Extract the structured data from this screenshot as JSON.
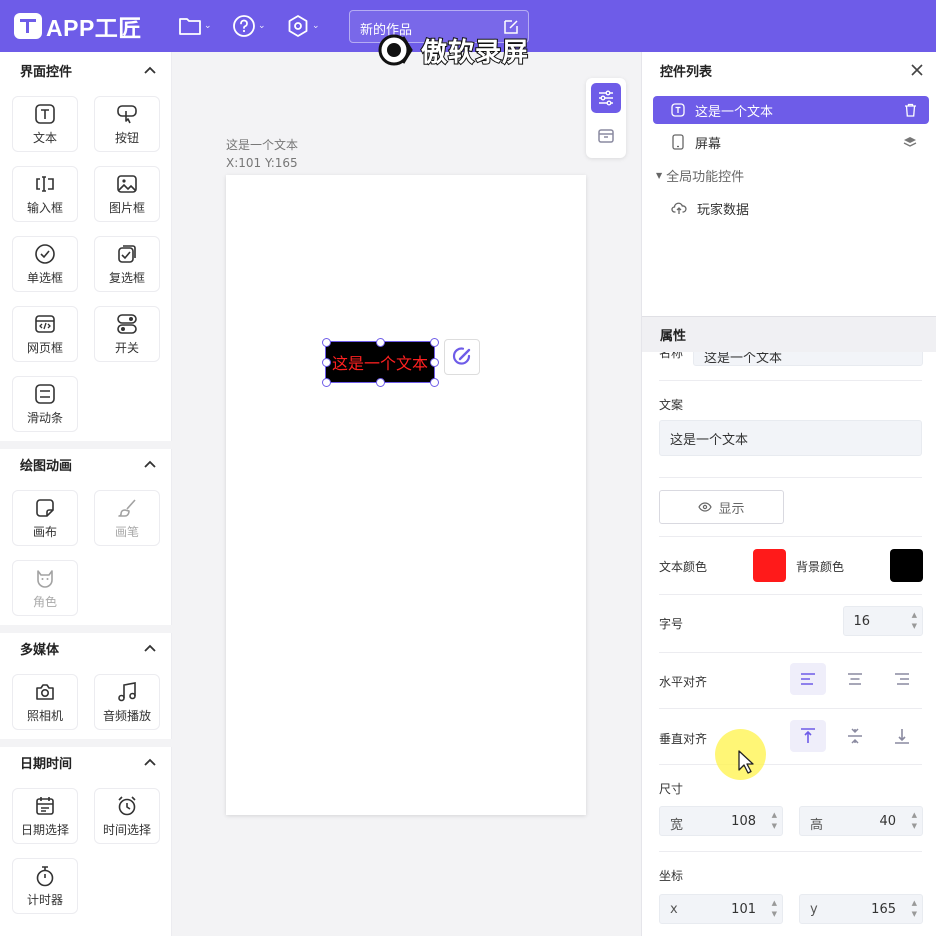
{
  "app": {
    "name": "APP工匠",
    "project_title": "新的作品",
    "watermark_text": "傲软录屏"
  },
  "toolbar_icons": [
    "folder-icon",
    "help-icon",
    "settings-icon",
    "edit-icon"
  ],
  "left_panel": {
    "sections": [
      {
        "title": "界面控件",
        "items": [
          {
            "label": "文本",
            "icon": "text-icon",
            "enabled": true
          },
          {
            "label": "按钮",
            "icon": "button-icon",
            "enabled": true
          },
          {
            "label": "输入框",
            "icon": "input-icon",
            "enabled": true
          },
          {
            "label": "图片框",
            "icon": "image-icon",
            "enabled": true
          },
          {
            "label": "单选框",
            "icon": "radio-icon",
            "enabled": true
          },
          {
            "label": "复选框",
            "icon": "checkbox-icon",
            "enabled": true
          },
          {
            "label": "网页框",
            "icon": "webview-icon",
            "enabled": true
          },
          {
            "label": "开关",
            "icon": "switch-icon",
            "enabled": true
          },
          {
            "label": "滑动条",
            "icon": "slider-icon",
            "enabled": true
          }
        ]
      },
      {
        "title": "绘图动画",
        "items": [
          {
            "label": "画布",
            "icon": "canvas-icon",
            "enabled": true
          },
          {
            "label": "画笔",
            "icon": "brush-icon",
            "enabled": false
          },
          {
            "label": "角色",
            "icon": "sprite-icon",
            "enabled": false
          }
        ]
      },
      {
        "title": "多媒体",
        "items": [
          {
            "label": "照相机",
            "icon": "camera-icon",
            "enabled": true
          },
          {
            "label": "音频播放",
            "icon": "music-icon",
            "enabled": true
          }
        ]
      },
      {
        "title": "日期时间",
        "items": [
          {
            "label": "日期选择",
            "icon": "calendar-icon",
            "enabled": true
          },
          {
            "label": "时间选择",
            "icon": "alarm-icon",
            "enabled": true
          },
          {
            "label": "计时器",
            "icon": "stopwatch-icon",
            "enabled": true
          }
        ]
      }
    ]
  },
  "canvas": {
    "selection_name": "这是一个文本",
    "selection_coords": "X:101 Y:165",
    "widget_text": "这是一个文本"
  },
  "control_list": {
    "title": "控件列表",
    "items": [
      {
        "label": "这是一个文本",
        "icon": "text-icon",
        "action_icon": "trash-icon",
        "selected": true
      },
      {
        "label": "屏幕",
        "icon": "phone-icon",
        "action_icon": "layers-icon",
        "selected": false
      }
    ],
    "group": {
      "label": "全局功能控件",
      "items": [
        {
          "label": "玩家数据",
          "icon": "cloud-icon"
        }
      ]
    }
  },
  "properties": {
    "title": "属性",
    "name_label": "名称",
    "name_value": "这是一个文本",
    "text_label": "文案",
    "text_value": "这是一个文本",
    "visibility_button": "显示",
    "text_color_label": "文本颜色",
    "text_color": "#ff1a1a",
    "bg_color_label": "背景颜色",
    "bg_color": "#000000",
    "font_size_label": "字号",
    "font_size": "16",
    "h_align_label": "水平对齐",
    "h_align_selected": "left",
    "v_align_label": "垂直对齐",
    "v_align_selected": "top",
    "size_label": "尺寸",
    "width_label": "宽",
    "width": "108",
    "height_label": "高",
    "height": "40",
    "position_label": "坐标",
    "x_label": "x",
    "x": "101",
    "y_label": "y",
    "y": "165"
  }
}
